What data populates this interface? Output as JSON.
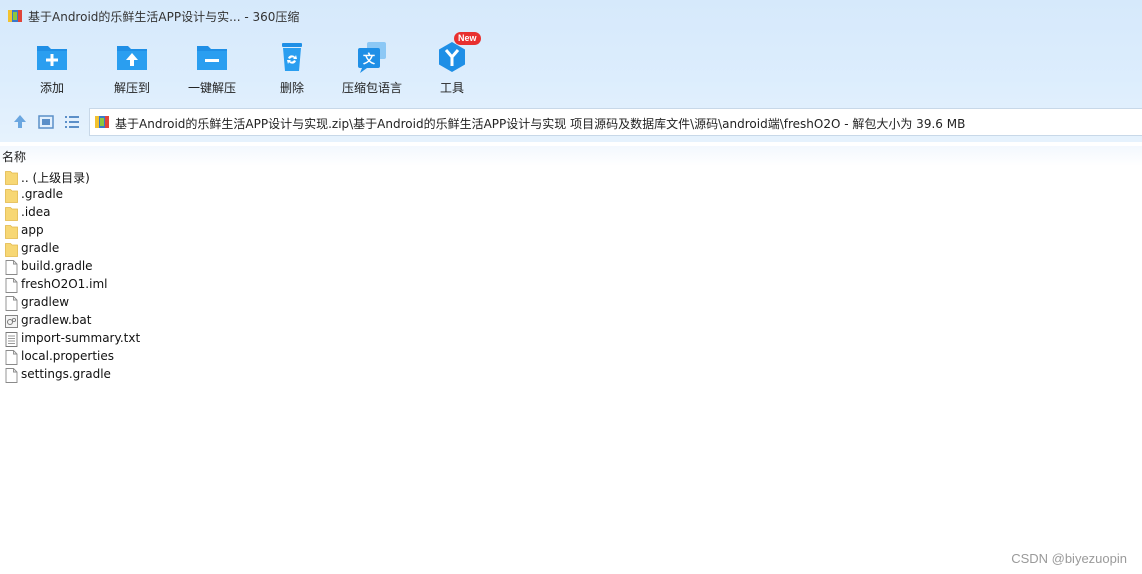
{
  "window": {
    "title": "基于Android的乐鲜生活APP设计与实... - 360压缩"
  },
  "toolbar": {
    "items": [
      {
        "label": "添加",
        "icon": "add-folder-icon"
      },
      {
        "label": "解压到",
        "icon": "extract-to-icon"
      },
      {
        "label": "一键解压",
        "icon": "one-click-extract-icon"
      },
      {
        "label": "删除",
        "icon": "delete-bin-icon"
      },
      {
        "label": "压缩包语言",
        "icon": "archive-language-icon"
      },
      {
        "label": "工具",
        "icon": "tools-icon",
        "badge": "New"
      }
    ]
  },
  "nav": {
    "path": "基于Android的乐鲜生活APP设计与实现.zip\\基于Android的乐鲜生活APP设计与实现 项目源码及数据库文件\\源码\\android端\\freshO2O - 解包大小为 39.6 MB"
  },
  "list": {
    "column_name": "名称",
    "files": [
      {
        "name": ".. (上级目录)",
        "type": "folder"
      },
      {
        "name": ".gradle",
        "type": "folder"
      },
      {
        "name": ".idea",
        "type": "folder"
      },
      {
        "name": "app",
        "type": "folder"
      },
      {
        "name": "gradle",
        "type": "folder"
      },
      {
        "name": "build.gradle",
        "type": "file"
      },
      {
        "name": "freshO2O1.iml",
        "type": "file"
      },
      {
        "name": "gradlew",
        "type": "file"
      },
      {
        "name": "gradlew.bat",
        "type": "bat"
      },
      {
        "name": "import-summary.txt",
        "type": "txt"
      },
      {
        "name": "local.properties",
        "type": "file"
      },
      {
        "name": "settings.gradle",
        "type": "file"
      }
    ]
  },
  "watermark": "CSDN @biyezuopin",
  "colors": {
    "accent_blue": "#1f8fe6",
    "folder_yellow": "#f7d774",
    "badge_red": "#e8302f"
  }
}
